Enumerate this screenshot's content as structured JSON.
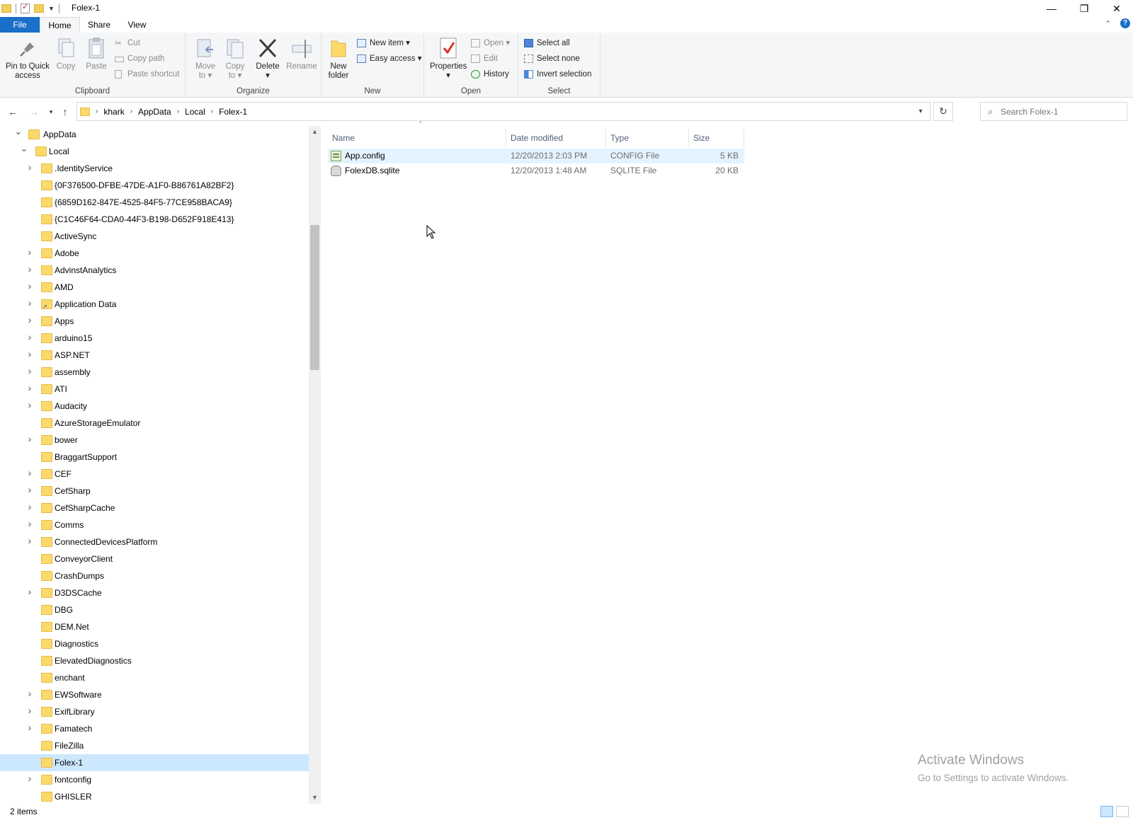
{
  "window": {
    "title": "Folex-1",
    "controls": {
      "minimize": "—",
      "restore": "❐",
      "close": "✕"
    }
  },
  "ribbon_tabs": [
    {
      "label": "File",
      "active": false
    },
    {
      "label": "Home",
      "active": true
    },
    {
      "label": "Share",
      "active": false
    },
    {
      "label": "View",
      "active": false
    }
  ],
  "ribbon": {
    "clipboard": {
      "label": "Clipboard",
      "pin": "Pin to Quick",
      "pin2": "access",
      "copy": "Copy",
      "paste": "Paste",
      "cut": "Cut",
      "copy_path": "Copy path",
      "paste_shortcut": "Paste shortcut"
    },
    "organize": {
      "label": "Organize",
      "move": "Move",
      "move2": "to ▾",
      "copyto": "Copy",
      "copyto2": "to ▾",
      "delete": "Delete",
      "delete2": "▾",
      "rename": "Rename"
    },
    "new": {
      "label": "New",
      "new_folder": "New",
      "new_folder2": "folder",
      "new_item": "New item ▾",
      "easy_access": "Easy access ▾"
    },
    "open": {
      "label": "Open",
      "properties": "Properties",
      "properties2": "▾",
      "open": "Open ▾",
      "edit": "Edit",
      "history": "History"
    },
    "select": {
      "label": "Select",
      "select_all": "Select all",
      "select_none": "Select none",
      "invert": "Invert selection"
    }
  },
  "address": {
    "crumbs": [
      "khark",
      "AppData",
      "Local",
      "Folex-1"
    ],
    "search_placeholder": "Search Folex-1"
  },
  "tree": [
    {
      "label": "AppData",
      "level": 0,
      "expanded": true,
      "has_children": true
    },
    {
      "label": "Local",
      "level": 1,
      "expanded": true,
      "has_children": true
    },
    {
      "label": ".IdentityService",
      "level": 2,
      "has_children": true
    },
    {
      "label": "{0F376500-DFBE-47DE-A1F0-B86761A82BF2}",
      "level": 2,
      "has_children": false
    },
    {
      "label": "{6859D162-847E-4525-84F5-77CE958BACA9}",
      "level": 2,
      "has_children": false
    },
    {
      "label": "{C1C46F64-CDA0-44F3-B198-D652F918E413}",
      "level": 2,
      "has_children": false
    },
    {
      "label": "ActiveSync",
      "level": 2,
      "has_children": false
    },
    {
      "label": "Adobe",
      "level": 2,
      "has_children": true
    },
    {
      "label": "AdvinstAnalytics",
      "level": 2,
      "has_children": true
    },
    {
      "label": "AMD",
      "level": 2,
      "has_children": true
    },
    {
      "label": "Application Data",
      "level": 2,
      "has_children": true,
      "shortcut": true
    },
    {
      "label": "Apps",
      "level": 2,
      "has_children": true
    },
    {
      "label": "arduino15",
      "level": 2,
      "has_children": true
    },
    {
      "label": "ASP.NET",
      "level": 2,
      "has_children": true
    },
    {
      "label": "assembly",
      "level": 2,
      "has_children": true
    },
    {
      "label": "ATI",
      "level": 2,
      "has_children": true
    },
    {
      "label": "Audacity",
      "level": 2,
      "has_children": true
    },
    {
      "label": "AzureStorageEmulator",
      "level": 2,
      "has_children": false
    },
    {
      "label": "bower",
      "level": 2,
      "has_children": true
    },
    {
      "label": "BraggartSupport",
      "level": 2,
      "has_children": false
    },
    {
      "label": "CEF",
      "level": 2,
      "has_children": true
    },
    {
      "label": "CefSharp",
      "level": 2,
      "has_children": true
    },
    {
      "label": "CefSharpCache",
      "level": 2,
      "has_children": true
    },
    {
      "label": "Comms",
      "level": 2,
      "has_children": true
    },
    {
      "label": "ConnectedDevicesPlatform",
      "level": 2,
      "has_children": true
    },
    {
      "label": "ConveyorClient",
      "level": 2,
      "has_children": false
    },
    {
      "label": "CrashDumps",
      "level": 2,
      "has_children": false
    },
    {
      "label": "D3DSCache",
      "level": 2,
      "has_children": true
    },
    {
      "label": "DBG",
      "level": 2,
      "has_children": false
    },
    {
      "label": "DEM.Net",
      "level": 2,
      "has_children": false
    },
    {
      "label": "Diagnostics",
      "level": 2,
      "has_children": false
    },
    {
      "label": "ElevatedDiagnostics",
      "level": 2,
      "has_children": false
    },
    {
      "label": "enchant",
      "level": 2,
      "has_children": false
    },
    {
      "label": "EWSoftware",
      "level": 2,
      "has_children": true
    },
    {
      "label": "ExifLibrary",
      "level": 2,
      "has_children": true
    },
    {
      "label": "Famatech",
      "level": 2,
      "has_children": true
    },
    {
      "label": "FileZilla",
      "level": 2,
      "has_children": false
    },
    {
      "label": "Folex-1",
      "level": 2,
      "has_children": false,
      "selected": true
    },
    {
      "label": "fontconfig",
      "level": 2,
      "has_children": true
    },
    {
      "label": "GHISLER",
      "level": 2,
      "has_children": false
    }
  ],
  "columns": [
    "Name",
    "Date modified",
    "Type",
    "Size"
  ],
  "files": [
    {
      "name": "App.config",
      "date": "12/20/2013 2:03 PM",
      "type": "CONFIG File",
      "size": "5 KB",
      "icon": "config-file-icon",
      "selected": true
    },
    {
      "name": "FolexDB.sqlite",
      "date": "12/20/2013 1:48 AM",
      "type": "SQLITE File",
      "size": "20 KB",
      "icon": "sqlite-file-icon",
      "selected": false
    }
  ],
  "watermark": {
    "line1": "Activate Windows",
    "line2": "Go to Settings to activate Windows."
  },
  "status": {
    "items": "2 items"
  }
}
